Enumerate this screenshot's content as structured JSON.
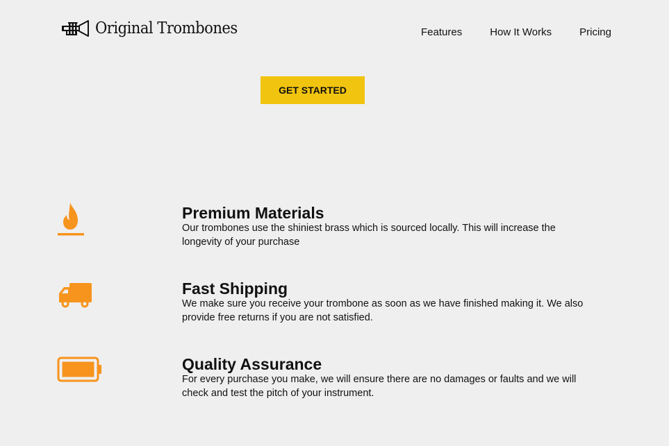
{
  "header": {
    "brand": "Original Trombones",
    "logo_icon": "trumpet-icon",
    "nav": [
      {
        "label": "Features"
      },
      {
        "label": "How It Works"
      },
      {
        "label": "Pricing"
      }
    ]
  },
  "hero": {
    "cta_label": "GET STARTED",
    "cta_color": "#f1c40f"
  },
  "features": [
    {
      "icon": "fire-icon",
      "title": "Premium Materials",
      "description": "Our trombones use the shiniest brass which is sourced locally. This will increase the longevity of your purchase"
    },
    {
      "icon": "truck-icon",
      "title": "Fast Shipping",
      "description": "We make sure you receive your trombone as soon as we have finished making it. We also provide free returns if you are not satisfied."
    },
    {
      "icon": "battery-full-icon",
      "title": "Quality Assurance",
      "description": "For every purchase you make, we will ensure there are no damages or faults and we will check and test the pitch of your instrument."
    }
  ],
  "colors": {
    "background": "#efefef",
    "icon_accent": "#f7941d",
    "cta": "#f1c40f"
  }
}
